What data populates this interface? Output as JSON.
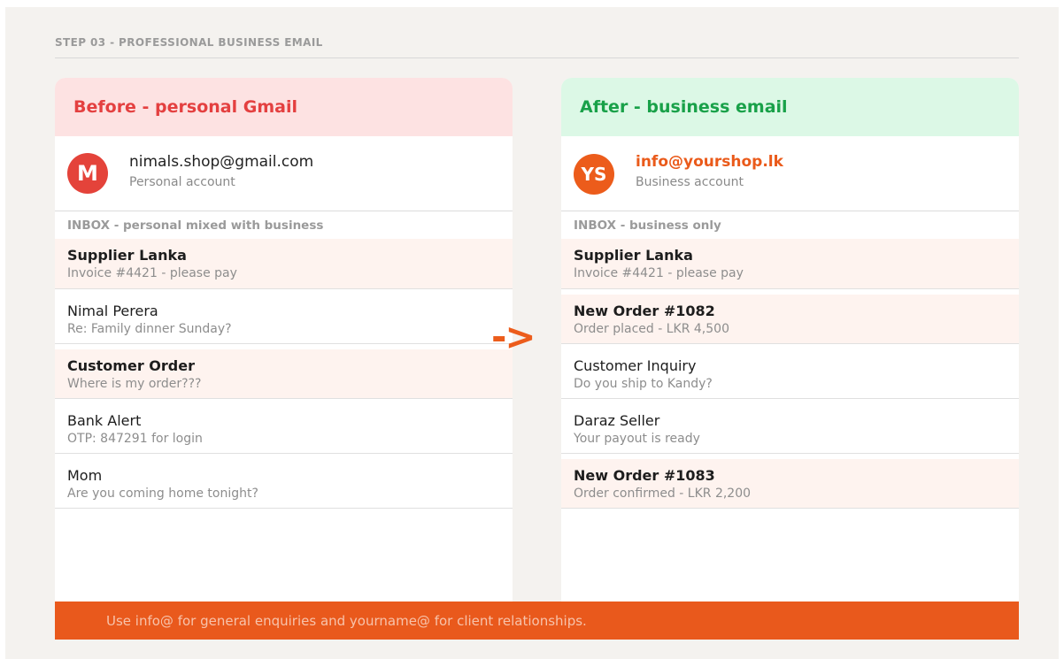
{
  "step_title": "STEP 03 - PROFESSIONAL BUSINESS EMAIL",
  "arrow": "->",
  "before": {
    "heading": "Before - personal Gmail",
    "avatar_initials": "M",
    "email": "nimals.shop@gmail.com",
    "account_type": "Personal account",
    "inbox_label": "INBOX - personal mixed with business",
    "messages": [
      {
        "from": "Supplier Lanka",
        "preview": "Invoice #4421 - please pay",
        "highlight": true
      },
      {
        "from": "Nimal Perera",
        "preview": "Re: Family dinner Sunday?",
        "highlight": false
      },
      {
        "from": "Customer Order",
        "preview": "Where is my order???",
        "highlight": true
      },
      {
        "from": "Bank Alert",
        "preview": "OTP: 847291 for login",
        "highlight": false
      },
      {
        "from": "Mom",
        "preview": "Are you coming home tonight?",
        "highlight": false
      }
    ]
  },
  "after": {
    "heading": "After - business email",
    "avatar_initials": "YS",
    "email": "info@yourshop.lk",
    "account_type": "Business account",
    "inbox_label": "INBOX - business only",
    "messages": [
      {
        "from": "Supplier Lanka",
        "preview": "Invoice #4421 - please pay",
        "highlight": true
      },
      {
        "from": "New Order #1082",
        "preview": "Order placed - LKR 4,500",
        "highlight": true
      },
      {
        "from": "Customer Inquiry",
        "preview": "Do you ship to Kandy?",
        "highlight": false
      },
      {
        "from": "Daraz Seller",
        "preview": "Your payout is ready",
        "highlight": false
      },
      {
        "from": "New Order #1083",
        "preview": "Order confirmed - LKR 2,200",
        "highlight": true
      }
    ]
  },
  "tip": "Use info@ for general enquiries and yourname@ for client relationships.",
  "colors": {
    "accent": "#ec5c1b",
    "before_head": "#e44040",
    "after_head": "#19a149"
  }
}
